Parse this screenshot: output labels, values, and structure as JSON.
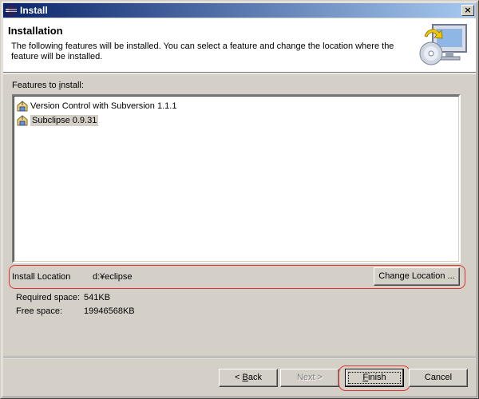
{
  "window": {
    "title": "Install",
    "close_glyph": "×"
  },
  "banner": {
    "heading": "Installation",
    "description": "The following features will be installed. You can select a feature and change the location where the feature will be installed."
  },
  "features": {
    "label_prefix": "Features to ",
    "label_mnemonic": "i",
    "label_suffix": "nstall:",
    "items": [
      {
        "label": "Version Control with Subversion 1.1.1",
        "selected": false
      },
      {
        "label": "Subclipse 0.9.31",
        "selected": true
      }
    ]
  },
  "location": {
    "label": "Install Location",
    "value": "d:¥eclipse",
    "change_button": "Change Location ..."
  },
  "space": {
    "required_label": "Required space:",
    "required_value": "541KB",
    "free_label": "Free space:",
    "free_value": "19946568KB"
  },
  "buttons": {
    "back_prefix": "< ",
    "back_mnemonic": "B",
    "back_suffix": "ack",
    "next_prefix": "Next ",
    "next_suffix": ">",
    "finish_mnemonic": "F",
    "finish_suffix": "inish",
    "cancel": "Cancel"
  },
  "colors": {
    "highlight_ring": "#e03030",
    "titlebar_start": "#0a246a",
    "titlebar_end": "#a6caf0"
  },
  "icons": {
    "app": "eclipse-icon",
    "feature": "feature-plugin-icon",
    "banner": "install-wizard-icon"
  }
}
